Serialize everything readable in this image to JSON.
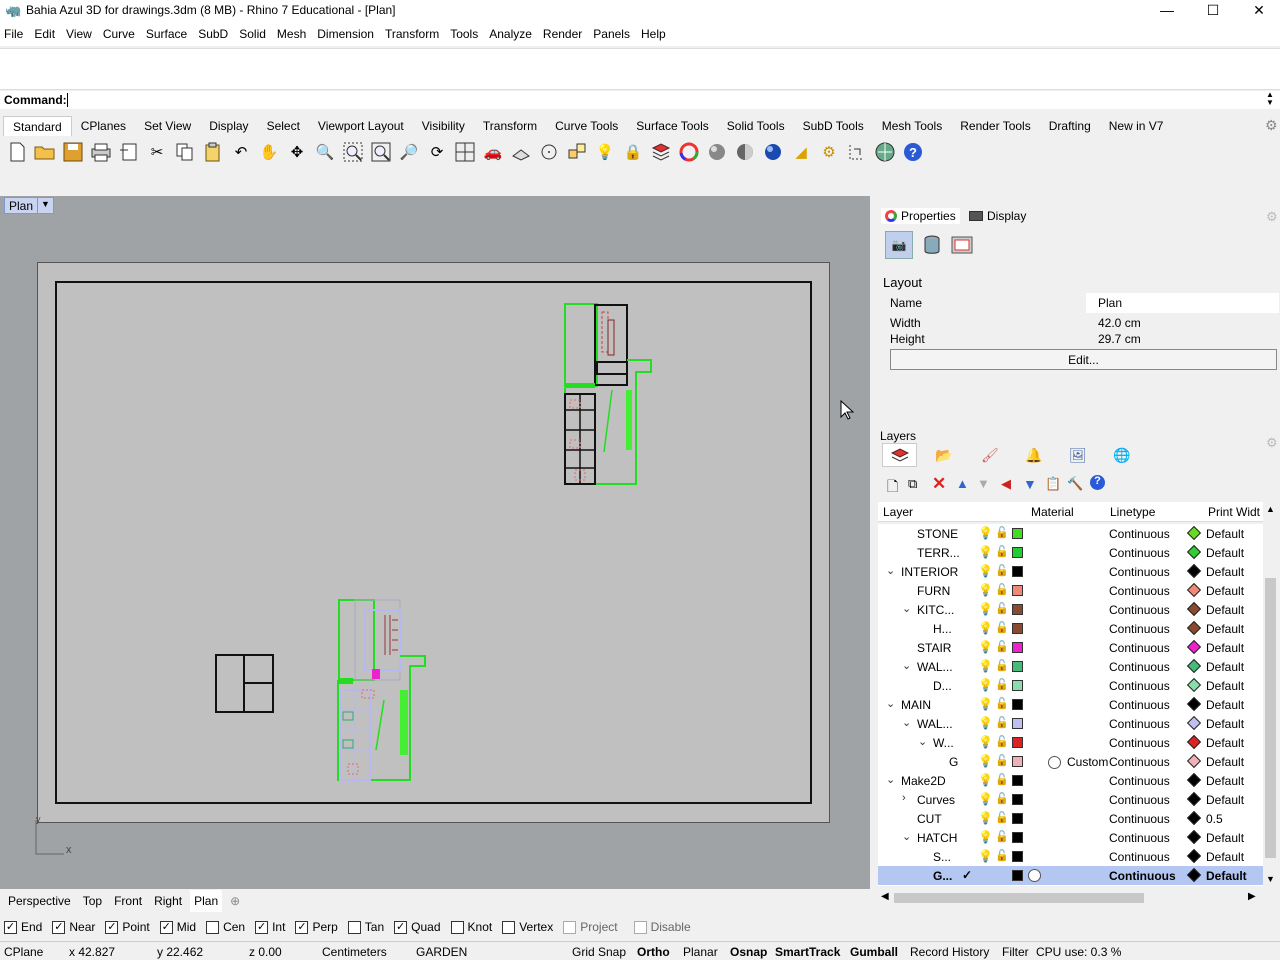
{
  "window": {
    "title": "Bahia Azul 3D for drawings.3dm (8 MB) - Rhino 7 Educational - [Plan]"
  },
  "menu": [
    "File",
    "Edit",
    "View",
    "Curve",
    "Surface",
    "SubD",
    "Solid",
    "Mesh",
    "Dimension",
    "Transform",
    "Tools",
    "Analyze",
    "Render",
    "Panels",
    "Help"
  ],
  "command": {
    "label": "Command:",
    "value": ""
  },
  "toolbar_tabs": [
    "Standard",
    "CPlanes",
    "Set View",
    "Display",
    "Select",
    "Viewport Layout",
    "Visibility",
    "Transform",
    "Curve Tools",
    "Surface Tools",
    "Solid Tools",
    "SubD Tools",
    "Mesh Tools",
    "Render Tools",
    "Drafting",
    "New in V7"
  ],
  "toolbar_icons": [
    "new-icon",
    "open-icon",
    "save-icon",
    "print-icon",
    "import-icon",
    "cut-icon",
    "copy-icon",
    "paste-icon",
    "undo-icon",
    "pan-icon",
    "rotate-view-icon",
    "zoom-icon",
    "zoom-window-icon",
    "zoom-extents-icon",
    "zoom-selected-icon",
    "rotate-icon",
    "four-viewports-icon",
    "car-icon",
    "cplane-icon",
    "circle-icon",
    "transform-icon",
    "light-icon",
    "lock-icon",
    "layer-icon",
    "color-wheel-icon",
    "shade-icon",
    "render-preview-icon",
    "render-icon",
    "material-icon",
    "options-icon",
    "dimension-icon",
    "globe-icon",
    "help-icon"
  ],
  "viewport": {
    "name": "Plan",
    "axis_x": "x",
    "axis_y": "y"
  },
  "viewport_tabs": [
    "Perspective",
    "Top",
    "Front",
    "Right",
    "Plan"
  ],
  "osnaps": [
    {
      "label": "End",
      "checked": true
    },
    {
      "label": "Near",
      "checked": true
    },
    {
      "label": "Point",
      "checked": true
    },
    {
      "label": "Mid",
      "checked": true
    },
    {
      "label": "Cen",
      "checked": false
    },
    {
      "label": "Int",
      "checked": true
    },
    {
      "label": "Perp",
      "checked": true
    },
    {
      "label": "Tan",
      "checked": false
    },
    {
      "label": "Quad",
      "checked": true
    },
    {
      "label": "Knot",
      "checked": false
    },
    {
      "label": "Vertex",
      "checked": false
    },
    {
      "label": "Project",
      "checked": false
    },
    {
      "label": "Disable",
      "checked": false
    }
  ],
  "status": {
    "cplane": "CPlane",
    "x": "x 42.827",
    "y": "y 22.462",
    "z": "z 0.00",
    "units": "Centimeters",
    "layer": "GARDEN",
    "grid_snap": "Grid Snap",
    "ortho": "Ortho",
    "planar": "Planar",
    "osnap": "Osnap",
    "smarttrack": "SmartTrack",
    "gumball": "Gumball",
    "record_history": "Record History",
    "filter": "Filter",
    "cpu": "CPU use: 0.3 %"
  },
  "properties": {
    "tab_properties": "Properties",
    "tab_display": "Display",
    "section": "Layout",
    "name_label": "Name",
    "name_value": "Plan",
    "width_label": "Width",
    "width_value": "42.0 cm",
    "height_label": "Height",
    "height_value": "29.7 cm",
    "edit_button": "Edit..."
  },
  "layers": {
    "title": "Layers",
    "headers": {
      "layer": "Layer",
      "material": "Material",
      "linetype": "Linetype",
      "print_width": "Print Widt"
    },
    "rows": [
      {
        "name": "STONE",
        "indent": 39,
        "exp": "",
        "color": "#44dd22",
        "lt": "Continuous",
        "pw": "Default",
        "pwc": "#66dd22",
        "mat": ""
      },
      {
        "name": "TERR...",
        "indent": 39,
        "exp": "",
        "color": "#22cc33",
        "lt": "Continuous",
        "pw": "Default",
        "pwc": "#33cc33",
        "mat": ""
      },
      {
        "name": "INTERIOR",
        "indent": 23,
        "exp": "⌄",
        "color": "#000000",
        "lt": "Continuous",
        "pw": "Default",
        "pwc": "#000000",
        "mat": ""
      },
      {
        "name": "FURN",
        "indent": 39,
        "exp": "",
        "color": "#f08878",
        "lt": "Continuous",
        "pw": "Default",
        "pwc": "#f08878",
        "mat": ""
      },
      {
        "name": "KITC...",
        "indent": 39,
        "exp": "⌄",
        "color": "#8a4a32",
        "lt": "Continuous",
        "pw": "Default",
        "pwc": "#8a4a32",
        "mat": ""
      },
      {
        "name": "H...",
        "indent": 55,
        "exp": "",
        "color": "#8a4a32",
        "lt": "Continuous",
        "pw": "Default",
        "pwc": "#8a4a32",
        "mat": ""
      },
      {
        "name": "STAIR",
        "indent": 39,
        "exp": "",
        "color": "#ee22cc",
        "lt": "Continuous",
        "pw": "Default",
        "pwc": "#ee22cc",
        "mat": ""
      },
      {
        "name": "WAL...",
        "indent": 39,
        "exp": "⌄",
        "color": "#44bb77",
        "lt": "Continuous",
        "pw": "Default",
        "pwc": "#44bb77",
        "mat": ""
      },
      {
        "name": "D...",
        "indent": 55,
        "exp": "",
        "color": "#88ddaa",
        "lt": "Continuous",
        "pw": "Default",
        "pwc": "#88ddaa",
        "mat": ""
      },
      {
        "name": "MAIN",
        "indent": 23,
        "exp": "⌄",
        "color": "#000000",
        "lt": "Continuous",
        "pw": "Default",
        "pwc": "#000000",
        "mat": ""
      },
      {
        "name": "WAL...",
        "indent": 39,
        "exp": "⌄",
        "color": "#c0c0f0",
        "lt": "Continuous",
        "pw": "Default",
        "pwc": "#c0c0f0",
        "mat": ""
      },
      {
        "name": "W...",
        "indent": 55,
        "exp": "⌄",
        "color": "#dd2222",
        "lt": "Continuous",
        "pw": "Default",
        "pwc": "#dd2222",
        "mat": ""
      },
      {
        "name": "G",
        "indent": 71,
        "exp": "",
        "color": "#f0b0b8",
        "lt": "Continuous",
        "pw": "Default",
        "pwc": "#f0b0b8",
        "mat": "Custom"
      },
      {
        "name": "Make2D",
        "indent": 23,
        "exp": "⌄",
        "color": "#000000",
        "lt": "Continuous",
        "pw": "Default",
        "pwc": "#000000",
        "mat": ""
      },
      {
        "name": "Curves",
        "indent": 39,
        "exp": "›",
        "color": "#000000",
        "lt": "Continuous",
        "pw": "Default",
        "pwc": "#000000",
        "mat": ""
      },
      {
        "name": "CUT",
        "indent": 39,
        "exp": "",
        "color": "#000000",
        "lt": "Continuous",
        "pw": "0.5",
        "pwc": "#000000",
        "mat": ""
      },
      {
        "name": "HATCH",
        "indent": 39,
        "exp": "⌄",
        "color": "#000000",
        "lt": "Continuous",
        "pw": "Default",
        "pwc": "#000000",
        "mat": ""
      },
      {
        "name": "S...",
        "indent": 55,
        "exp": "",
        "color": "#000000",
        "lt": "Continuous",
        "pw": "Default",
        "pwc": "#000000",
        "mat": ""
      },
      {
        "name": "G...",
        "indent": 55,
        "exp": "",
        "color": "#000000",
        "lt": "Continuous",
        "pw": "Default",
        "pwc": "#000000",
        "mat": "",
        "current": true
      }
    ]
  }
}
